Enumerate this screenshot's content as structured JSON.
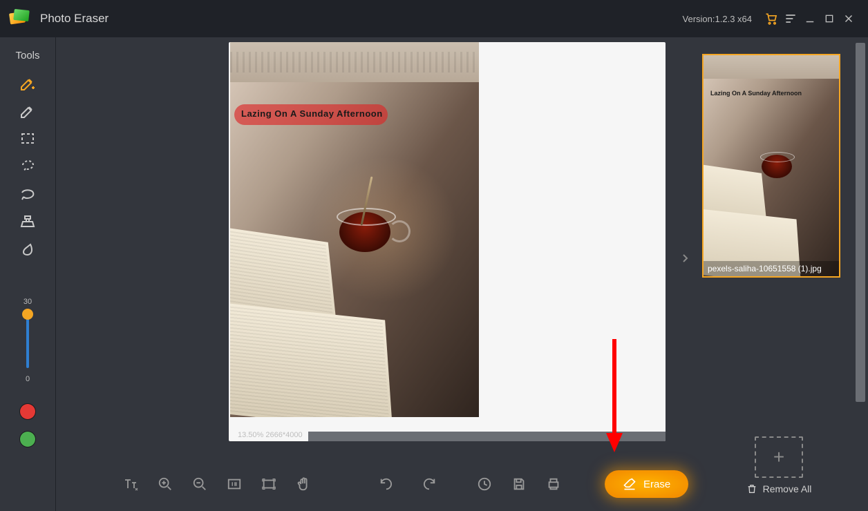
{
  "app": {
    "title": "Photo Eraser",
    "version": "Version:1.2.3 x64"
  },
  "sidebar": {
    "heading": "Tools",
    "slider": {
      "max": "30",
      "min": "0"
    }
  },
  "canvas": {
    "zoom_text": "13.50% 2666*4000",
    "watermark_text": "Lazing On A Sunday Afternoon"
  },
  "actions": {
    "erase_label": "Erase"
  },
  "right_panel": {
    "thumb_filename": "pexels-saliha-10651558 (1).jpg",
    "thumb_watermark": "Lazing On A Sunday Afternoon",
    "remove_all_label": "Remove All"
  }
}
